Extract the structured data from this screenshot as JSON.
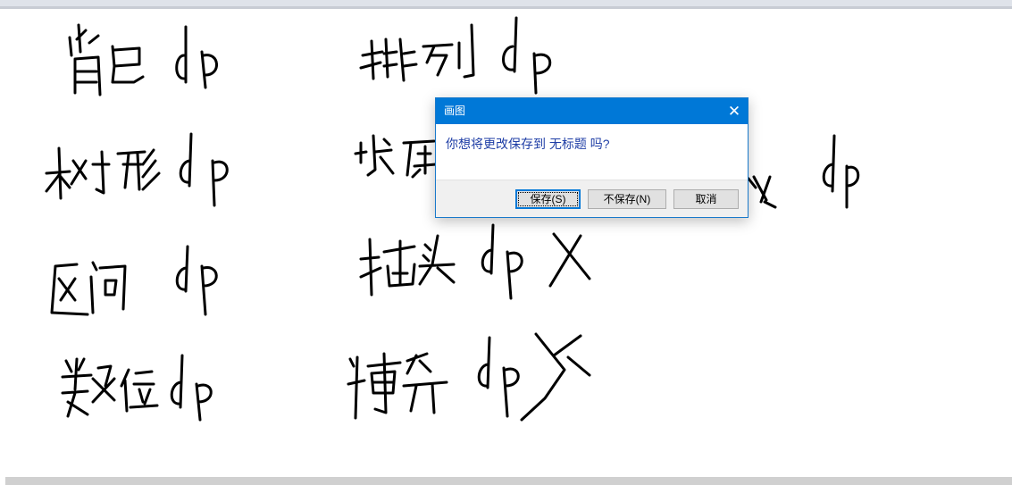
{
  "dialog": {
    "title": "画图",
    "close_glyph": "✕",
    "message": "你想将更改保存到 无标题 吗?",
    "buttons": {
      "save": "保存(S)",
      "dont_save": "不保存(N)",
      "cancel": "取消"
    }
  },
  "colors": {
    "titlebar": "#0078d7",
    "message_text": "#1f3ea6",
    "ink": "#000000"
  },
  "handwriting": [
    {
      "id": "beibao",
      "text": "背包dp"
    },
    {
      "id": "pailie",
      "text": "排列dp"
    },
    {
      "id": "shuxing",
      "text": "树形dp"
    },
    {
      "id": "zhuangya",
      "text": "状压dp"
    },
    {
      "id": "shuwei_right",
      "text": "度dp"
    },
    {
      "id": "qujian",
      "text": "区间dp"
    },
    {
      "id": "chatou",
      "text": "插头dp"
    },
    {
      "id": "shuwei",
      "text": "数位dp"
    },
    {
      "id": "boyi",
      "text": "博弈dp"
    }
  ]
}
